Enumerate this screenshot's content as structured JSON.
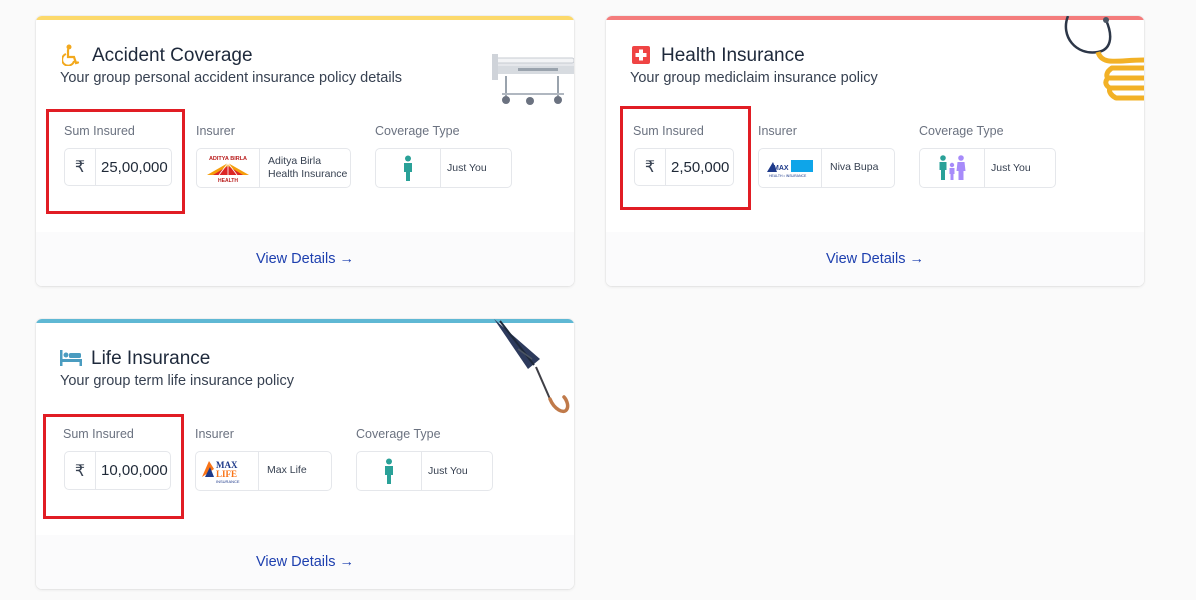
{
  "cards": [
    {
      "title": "Accident Coverage",
      "subtitle": "Your group personal accident insurance policy details",
      "accent": "#fcd96b",
      "icon": "wheelchair-icon",
      "sum_label": "Sum Insured",
      "currency": "₹",
      "sum_value": "25,00,000",
      "insurer_label": "Insurer",
      "insurer_name": "Aditya Birla Health Insurance",
      "coverage_label": "Coverage Type",
      "coverage_value": "Just You",
      "view_details": "View Details →",
      "logo_text": {
        "line1": "ADITYA BIRLA",
        "line2": "HEALTH"
      }
    },
    {
      "title": "Health Insurance",
      "subtitle": "Your group mediclaim insurance policy",
      "accent": "#f47c7c",
      "icon": "medical-cross-icon",
      "sum_label": "Sum Insured",
      "currency": "₹",
      "sum_value": "2,50,000",
      "insurer_label": "Insurer",
      "insurer_name": "Niva Bupa",
      "coverage_label": "Coverage Type",
      "coverage_value": "Just You",
      "view_details": "View Details →",
      "logo_text": {
        "line1": "MAX",
        "line2": ""
      }
    },
    {
      "title": "Life Insurance",
      "subtitle": "Your group term life insurance policy",
      "accent": "#5fb8d4",
      "icon": "bed-icon",
      "sum_label": "Sum Insured",
      "currency": "₹",
      "sum_value": "10,00,000",
      "insurer_label": "Insurer",
      "insurer_name": "Max Life",
      "coverage_label": "Coverage Type",
      "coverage_value": "Just You",
      "view_details": "View Details →",
      "logo_text": {
        "line1": "MAX",
        "line2": "LIFE",
        "line3": "INSURANCE"
      }
    }
  ],
  "colors": {
    "link": "#1e40af",
    "highlight": "#e11d24",
    "person_icon": "#2aa198"
  }
}
